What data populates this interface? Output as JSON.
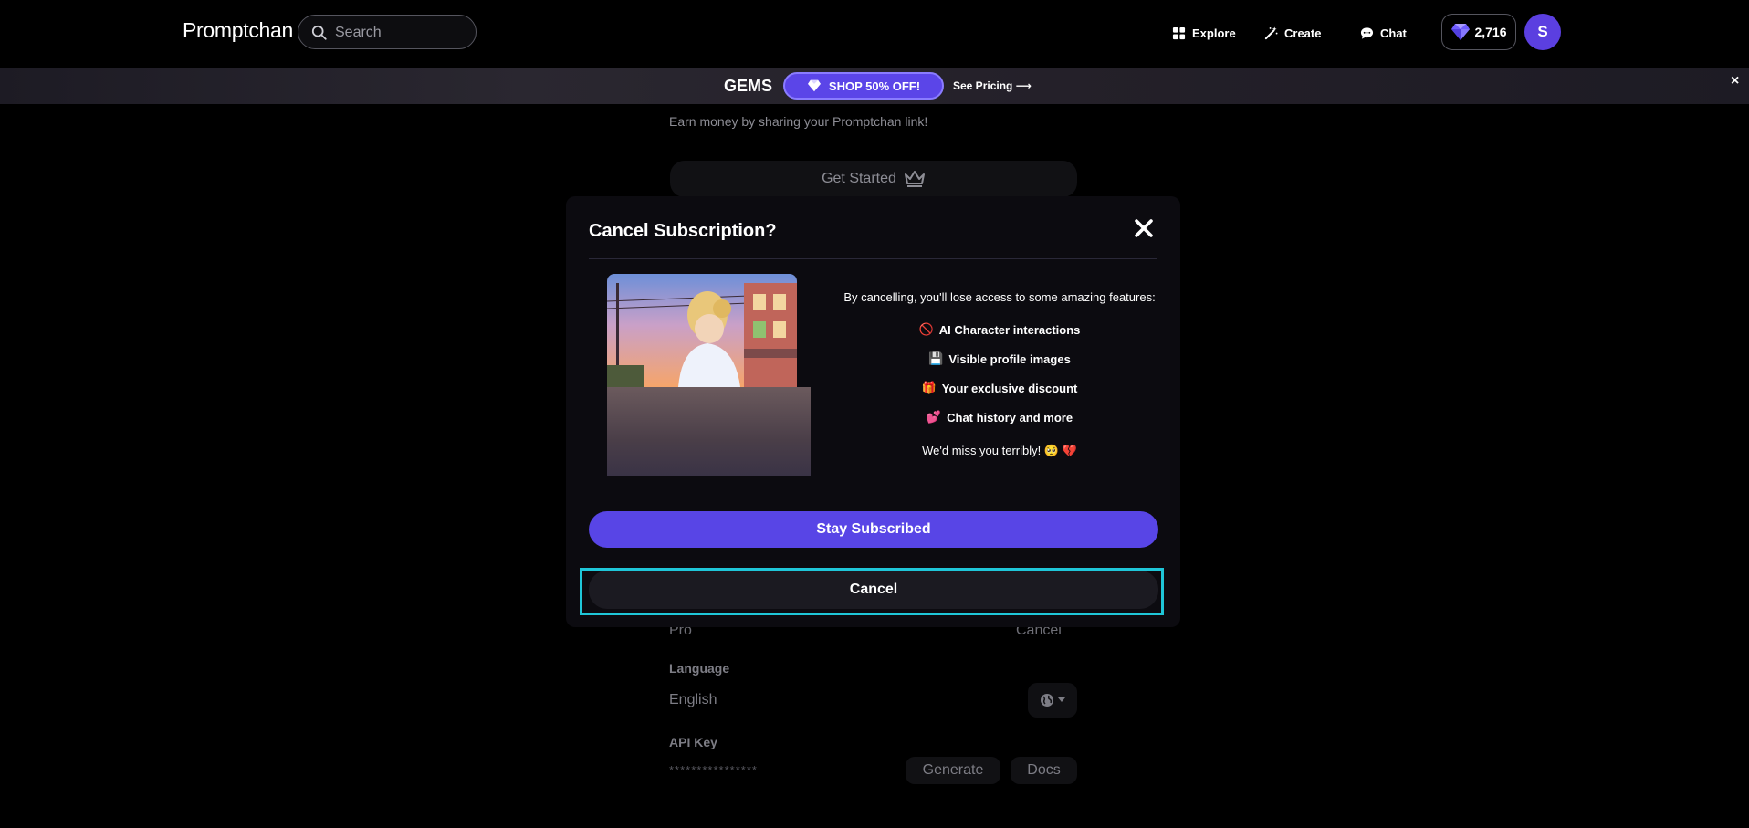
{
  "header": {
    "logo": "Promptchan",
    "search_placeholder": "Search",
    "nav": [
      {
        "label": "Explore",
        "icon": "grid-icon"
      },
      {
        "label": "Create",
        "icon": "magic-wand-icon"
      },
      {
        "label": "Chat",
        "icon": "chat-bubble-icon"
      }
    ],
    "gems_count": "2,716",
    "avatar_initial": "S"
  },
  "banner": {
    "title": "GEMS",
    "shop_label": "SHOP 50% OFF!",
    "pricing_label": "See Pricing ⟶",
    "close_label": "×"
  },
  "background": {
    "earn_text": "Earn money by sharing your Promptchan link!",
    "get_started_label": "Get Started",
    "plan_name": "Pro",
    "plan_cancel_label": "Cancel",
    "language_label": "Language",
    "language_value": "English",
    "api_key_label": "API Key",
    "api_key_value": "****************",
    "generate_label": "Generate",
    "docs_label": "Docs"
  },
  "modal": {
    "title": "Cancel Subscription?",
    "intro": "By cancelling, you'll lose access to some amazing features:",
    "features": [
      {
        "emoji": "🚫",
        "label": "AI Character interactions"
      },
      {
        "emoji": "💾",
        "label": "Visible profile images"
      },
      {
        "emoji": "🎁",
        "label": "Your exclusive discount"
      },
      {
        "emoji": "💕",
        "label": "Chat history and more"
      }
    ],
    "miss_text": "We'd miss you terribly! 🥺 💔",
    "stay_label": "Stay Subscribed",
    "cancel_label": "Cancel"
  },
  "colors": {
    "accent": "#5845e6",
    "highlight": "#1fc6d8",
    "background": "#000000",
    "modal_bg": "#0c0b10"
  }
}
